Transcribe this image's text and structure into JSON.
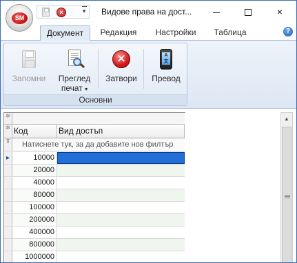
{
  "window": {
    "title": "Видове права на дост...",
    "app_logo": "SM",
    "controls": {
      "minimize": "minimize-icon",
      "maximize": "maximize-icon",
      "close": "×"
    }
  },
  "quick_access": {
    "customize_glyph": "▾",
    "close_glyph": "×"
  },
  "ribbon": {
    "tabs": [
      {
        "label": "Документ",
        "active": true
      },
      {
        "label": "Редакция",
        "active": false
      },
      {
        "label": "Настройки",
        "active": false
      },
      {
        "label": "Таблица",
        "active": false
      }
    ],
    "help_glyph": "?",
    "group_label": "Основни",
    "buttons": {
      "save": {
        "label": "Запомни",
        "enabled": false
      },
      "preview": {
        "label": "Преглед",
        "label2": "печат",
        "dropdown": "▾"
      },
      "close": {
        "label": "Затвори",
        "glyph": "✕"
      },
      "translate": {
        "label": "Превод",
        "screen_text": "A文"
      }
    }
  },
  "grid": {
    "group_indicator": "✲",
    "header_indicator": "✲",
    "filter_indicator": "⊽",
    "row_indicator": "▸",
    "columns": [
      "Код",
      "Вид достъп"
    ],
    "filter_prompt": "Натиснете тук, за да добавите нов филтър",
    "rows": [
      {
        "code": "10000",
        "type": ""
      },
      {
        "code": "20000",
        "type": ""
      },
      {
        "code": "40000",
        "type": ""
      },
      {
        "code": "80000",
        "type": ""
      },
      {
        "code": "100000",
        "type": ""
      },
      {
        "code": "200000",
        "type": ""
      },
      {
        "code": "400000",
        "type": ""
      },
      {
        "code": "800000",
        "type": ""
      },
      {
        "code": "1000000",
        "type": ""
      }
    ],
    "selected_row": 0
  },
  "scrollbar": {
    "up_glyph": "▲"
  },
  "colors": {
    "selection": "#1f6fd6",
    "ribbon_bg": "#dde7f3",
    "accent": "#3c6fb0"
  }
}
